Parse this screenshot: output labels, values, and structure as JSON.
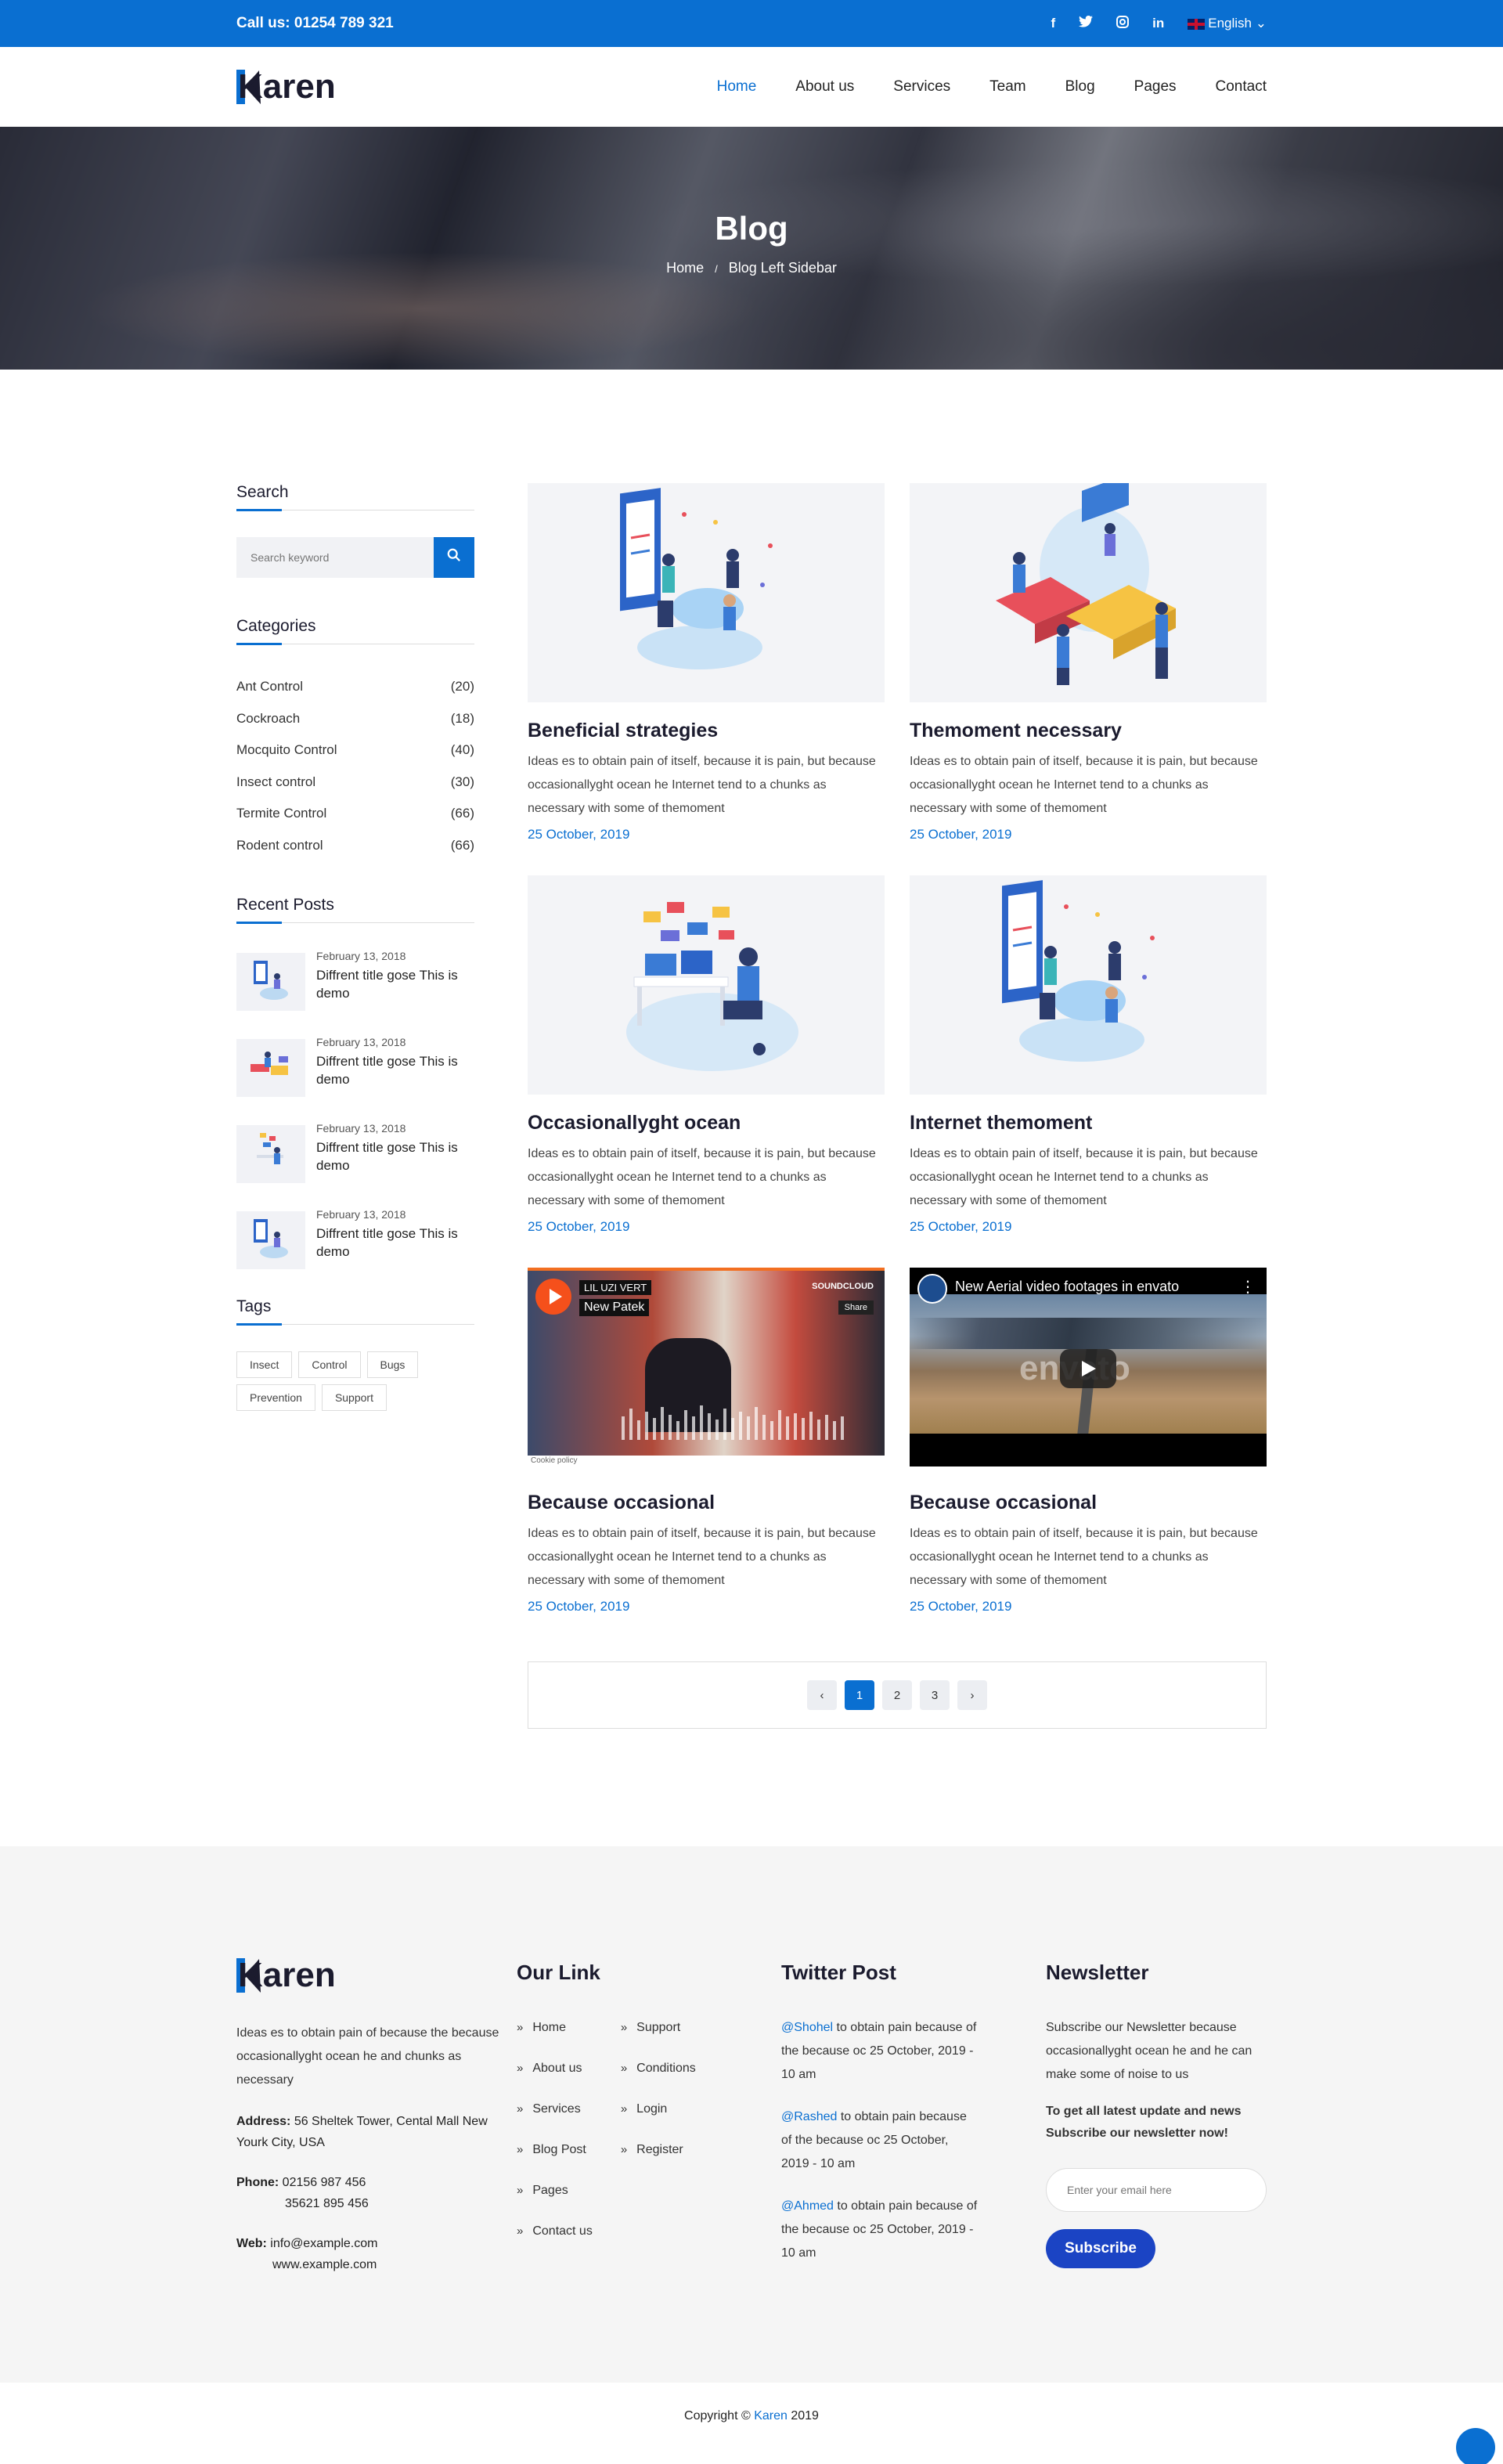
{
  "topbar": {
    "phone": "Call us: 01254 789 321",
    "social": [
      "f",
      "t",
      "ig",
      "in"
    ],
    "language": "English"
  },
  "header": {
    "logo": "Karen",
    "nav": [
      "Home",
      "About us",
      "Services",
      "Team",
      "Blog",
      "Pages",
      "Contact"
    ],
    "active_nav": "Home"
  },
  "banner": {
    "title": "Blog",
    "breadcrumb_home": "Home",
    "breadcrumb_sep": "/",
    "breadcrumb_current": "Blog Left Sidebar"
  },
  "sidebar": {
    "search_title": "Search",
    "search_placeholder": "Search keyword",
    "categories_title": "Categories",
    "categories": [
      {
        "name": "Ant Control",
        "count": "(20)"
      },
      {
        "name": "Cockroach",
        "count": "(18)"
      },
      {
        "name": "Mocquito Control",
        "count": "(40)"
      },
      {
        "name": "Insect control",
        "count": "(30)"
      },
      {
        "name": "Termite Control",
        "count": "(66)"
      },
      {
        "name": "Rodent control",
        "count": "(66)"
      }
    ],
    "recent_title": "Recent Posts",
    "recent": [
      {
        "date": "February 13, 2018",
        "title": "Diffrent title gose This is demo"
      },
      {
        "date": "February 13, 2018",
        "title": "Diffrent title gose This is demo"
      },
      {
        "date": "February 13, 2018",
        "title": "Diffrent title gose This is demo"
      },
      {
        "date": "February 13, 2018",
        "title": "Diffrent title gose This is demo"
      }
    ],
    "tags_title": "Tags",
    "tags": [
      "Insect",
      "Control",
      "Bugs",
      "Prevention",
      "Support"
    ]
  },
  "posts": [
    {
      "title": "Beneficial strategies",
      "excerpt": "Ideas es to obtain pain of itself, because it is pain, but because occasionallyght ocean he Internet tend to a chunks as necessary with some of themoment",
      "date": "25 October, 2019"
    },
    {
      "title": "Themoment necessary",
      "excerpt": "Ideas es to obtain pain of itself, because it is pain, but because occasionallyght ocean he Internet tend to a chunks as necessary with some of themoment",
      "date": "25 October, 2019"
    },
    {
      "title": "Occasionallyght ocean",
      "excerpt": "Ideas es to obtain pain of itself, because it is pain, but because occasionallyght ocean he Internet tend to a chunks as necessary with some of themoment",
      "date": "25 October, 2019"
    },
    {
      "title": "Internet themoment",
      "excerpt": "Ideas es to obtain pain of itself, because it is pain, but because occasionallyght ocean he Internet tend to a chunks as necessary with some of themoment",
      "date": "25 October, 2019"
    },
    {
      "title": "Because occasional",
      "excerpt": "Ideas es to obtain pain of itself, because it is pain, but because occasionallyght ocean he Internet tend to a chunks as necessary with some of themoment",
      "date": "25 October, 2019"
    },
    {
      "title": "Because occasional",
      "excerpt": "Ideas es to obtain pain of itself, because it is pain, but because occasionallyght ocean he Internet tend to a chunks as necessary with some of themoment",
      "date": "25 October, 2019"
    }
  ],
  "soundcloud": {
    "artist": "LIL UZI VERT",
    "track": "New Patek",
    "brand": "SOUNDCLOUD",
    "share": "Share",
    "cookie": "Cookie policy"
  },
  "youtube": {
    "title": "New Aerial video footages in envato",
    "watermark": "envato"
  },
  "pagination": {
    "pages": [
      "1",
      "2",
      "3"
    ],
    "active": "1",
    "prev": "‹",
    "next": "›"
  },
  "footer": {
    "logo": "Karen",
    "about": "Ideas es to obtain pain of because the because occasionallyght ocean he and chunks as necessary",
    "address_label": "Address:",
    "address": "56 Sheltek Tower, Cental Mall New Yourk City, USA",
    "phone_label": "Phone:",
    "phone1": "02156 987 456",
    "phone2": "35621 895 456",
    "web_label": "Web:",
    "web1": "info@example.com",
    "web2": "www.example.com",
    "links_title": "Our Link",
    "links_col1": [
      "Home",
      "About us",
      "Services",
      "Blog Post",
      "Pages",
      "Contact us"
    ],
    "links_col2": [
      "Support",
      "Conditions",
      "Login",
      "Register"
    ],
    "twitter_title": "Twitter Post",
    "tweets": [
      {
        "handle": "@Shohel",
        "text": " to obtain pain because of the because oc 25 October, 2019 - 10 am"
      },
      {
        "handle": "@Rashed",
        "text": " to obtain pain because of the because oc 25 October, 2019 - 10 am"
      },
      {
        "handle": "@Ahmed",
        "text": " to obtain pain because of the because oc 25 October, 2019 - 10 am"
      }
    ],
    "newsletter_title": "Newsletter",
    "newsletter_text": "Subscribe our Newsletter because occasionallyght ocean he and he can make some of noise to us",
    "newsletter_strong": "To get all latest update and news Subscribe our newsletter now!",
    "email_placeholder": "Enter your email here",
    "subscribe": "Subscribe"
  },
  "copyright": {
    "prefix": "Copyright © ",
    "brand": "Karen",
    "suffix": " 2019"
  },
  "colors": {
    "accent": "#0a6fd1",
    "subscribe": "#1b44c4",
    "footer_bg": "#f5f5f5"
  }
}
